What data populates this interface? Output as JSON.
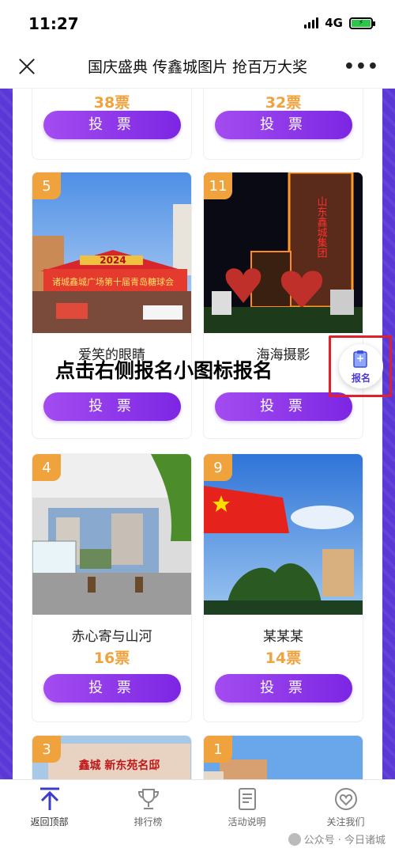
{
  "status": {
    "time": "11:27",
    "network": "4G"
  },
  "nav": {
    "title": "国庆盛典 传鑫城图片 抢百万大奖"
  },
  "vote_label": "投 票",
  "partial_top": [
    {
      "votes": "38票"
    },
    {
      "votes": "32票"
    }
  ],
  "entries": [
    {
      "number": "5",
      "name": "爱笑的眼睛",
      "photo_text": "诸城鑫城广场第十届青岛糖球会",
      "photo_year": "2024"
    },
    {
      "number": "11",
      "name": "海海摄影",
      "photo_text": "山东鑫城集团"
    },
    {
      "number": "4",
      "name": "赤心寄与山河",
      "votes": "16票"
    },
    {
      "number": "9",
      "name": "某某某",
      "votes": "14票"
    }
  ],
  "partial_bottom": [
    {
      "number": "3",
      "photo_text": "鑫城 新东苑名邸"
    },
    {
      "number": "1"
    }
  ],
  "overlay_instruction": "点击右侧报名小图标报名",
  "signup": {
    "label": "报名"
  },
  "tabs": [
    {
      "label": "返回顶部",
      "icon": "arrow-up-icon"
    },
    {
      "label": "排行榜",
      "icon": "trophy-icon"
    },
    {
      "label": "活动说明",
      "icon": "document-icon"
    },
    {
      "label": "关注我们",
      "icon": "heart-icon"
    }
  ],
  "watermark": "公众号 · 今日诸城",
  "colors": {
    "accent_purple": "#8b33ea",
    "vote_orange": "#f0a23c",
    "background_purple": "#5a38d6",
    "highlight_red": "#e0202a"
  }
}
